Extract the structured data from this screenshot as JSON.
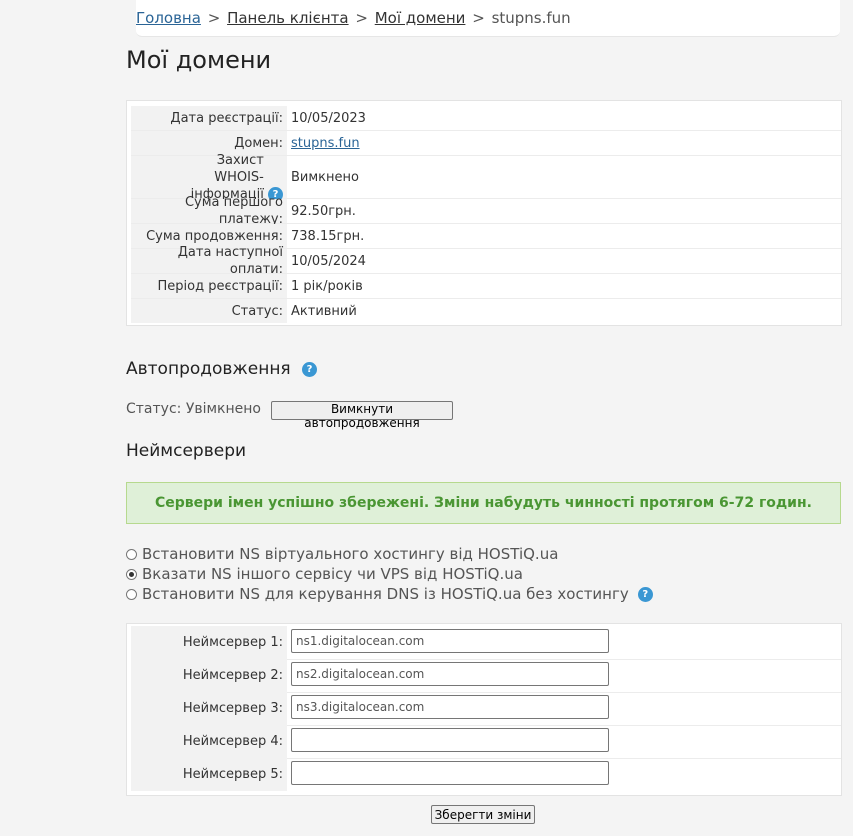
{
  "breadcrumb": {
    "home": "Головна",
    "panel": "Панель клієнта",
    "domains": "Мої домени",
    "current": "stupns.fun",
    "separator": ">"
  },
  "page_title": "Мої домени",
  "info": {
    "rows": [
      {
        "label": "Дата реєстрації:",
        "value": "10/05/2023"
      },
      {
        "label": "Домен:",
        "value": "stupns.fun"
      },
      {
        "label": "Захист WHOIS-інформації",
        "value": "Вимкнено"
      },
      {
        "label": "Сума першого платежу:",
        "value": "92.50грн."
      },
      {
        "label": "Сума продовження:",
        "value": "738.15грн."
      },
      {
        "label": "Дата наступної оплати:",
        "value": "10/05/2024"
      },
      {
        "label": "Період реєстрації:",
        "value": "1 рік/років"
      },
      {
        "label": "Статус:",
        "value": "Активний"
      }
    ]
  },
  "autorenew": {
    "title": "Автопродовження",
    "status": "Статус: Увімкнено",
    "button": "Вимкнути автопродовження"
  },
  "nameservers": {
    "title": "Неймсервери",
    "success_message": "Сервери імен успішно збережені. Зміни набудуть чинності протягом 6-72 годин.",
    "options": [
      {
        "label": "Встановити NS віртуального хостингу від HOSTiQ.ua",
        "checked": false
      },
      {
        "label": "Вказати NS іншого сервісу чи VPS від HOSTiQ.ua",
        "checked": true
      },
      {
        "label": "Встановити NS для керування DNS із HOSTiQ.ua без хостингу",
        "checked": false
      }
    ],
    "fields": [
      {
        "label": "Неймсервер 1:",
        "value": "ns1.digitalocean.com"
      },
      {
        "label": "Неймсервер 2:",
        "value": "ns2.digitalocean.com"
      },
      {
        "label": "Неймсервер 3:",
        "value": "ns3.digitalocean.com"
      },
      {
        "label": "Неймсервер 4:",
        "value": ""
      },
      {
        "label": "Неймсервер 5:",
        "value": ""
      }
    ],
    "save_button": "Зберегти зміни"
  },
  "help_glyph": "?",
  "icons": {
    "help": "help-circle-icon"
  },
  "colors": {
    "link": "#2a6496",
    "success_bg": "#dff0d8",
    "success_text": "#4a9633",
    "help_icon": "#3a97d3"
  }
}
